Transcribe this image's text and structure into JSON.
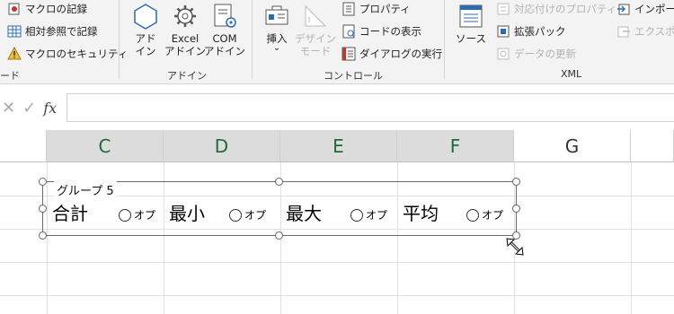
{
  "ribbon": {
    "macro_group": {
      "record_macro": "マクロの記録",
      "relative_ref": "相対参照で記録",
      "macro_security": "マクロのセキュリティ",
      "group_label": "ード"
    },
    "addin_group": {
      "addin_label": "アド\nイン",
      "excel_addin_label": "Excel\nアドイン",
      "com_addin_label": "COM\nアドイン",
      "group_label": "アドイン"
    },
    "control_group": {
      "insert_label": "挿入",
      "insert_arrow": "⌄",
      "design_mode_label": "デザイン\nモード",
      "properties": "プロパティ",
      "view_code": "コードの表示",
      "run_dialog": "ダイアログの実行",
      "group_label": "コントロール"
    },
    "xml_group": {
      "source_label": "ソース",
      "map_properties": "対応付けのプロパティ",
      "expansion_packs": "拡張パック",
      "refresh_data": "データの更新",
      "import": "インポート",
      "export": "エクスポー",
      "group_label": "XML"
    }
  },
  "formula_bar": {
    "cancel": "✕",
    "enter": "✓",
    "fx": "fx",
    "value": ""
  },
  "grid": {
    "columns": [
      "C",
      "D",
      "E",
      "F",
      "G"
    ]
  },
  "group_control": {
    "title": "グループ 5",
    "labels": [
      "合計",
      "最小",
      "最大",
      "平均"
    ],
    "option_label": "オプ"
  },
  "colors": {
    "selected_header_text": "#1e6b3a",
    "selected_header_bg": "#dcdcdc",
    "ribbon_bg": "#f3f3f3",
    "icon_blue": "#2b6cb0"
  }
}
